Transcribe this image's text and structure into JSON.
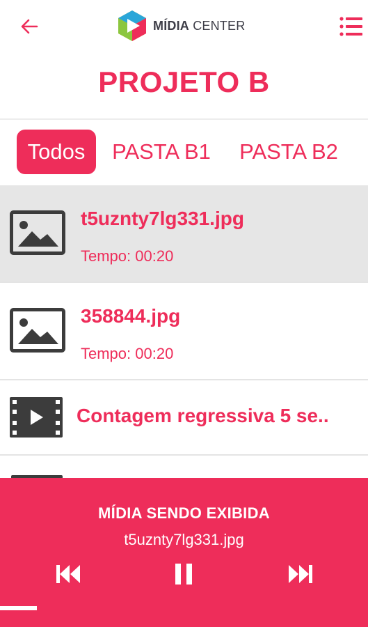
{
  "header": {
    "logo_text_bold": "MÍDIA",
    "logo_text_regular": "CENTER",
    "back_icon": "arrow-left-icon",
    "menu_icon": "list-icon"
  },
  "page": {
    "title": "PROJETO B"
  },
  "tabs": [
    {
      "label": "Todos",
      "active": true
    },
    {
      "label": "PASTA B1",
      "active": false
    },
    {
      "label": "PASTA B2",
      "active": false
    }
  ],
  "media_list": [
    {
      "type": "image",
      "icon": "image-icon",
      "name": "t5uznty7lg331.jpg",
      "time": "Tempo: 00:20",
      "selected": true
    },
    {
      "type": "image",
      "icon": "image-icon",
      "name": "358844.jpg",
      "time": "Tempo: 00:20",
      "selected": false
    },
    {
      "type": "video",
      "icon": "video-icon",
      "name": "Contagem regressiva 5 se..",
      "time": "",
      "selected": false
    }
  ],
  "player": {
    "label": "MÍDIA SENDO EXIBIDA",
    "current_file": "t5uznty7lg331.jpg",
    "progress": 0.1,
    "controls": [
      "skip-previous-icon",
      "pause-icon",
      "skip-next-icon"
    ]
  },
  "colors": {
    "accent": "#ee2d5a",
    "selected_row": "#e6e6e6",
    "icon_gray": "#3c3c3c"
  }
}
